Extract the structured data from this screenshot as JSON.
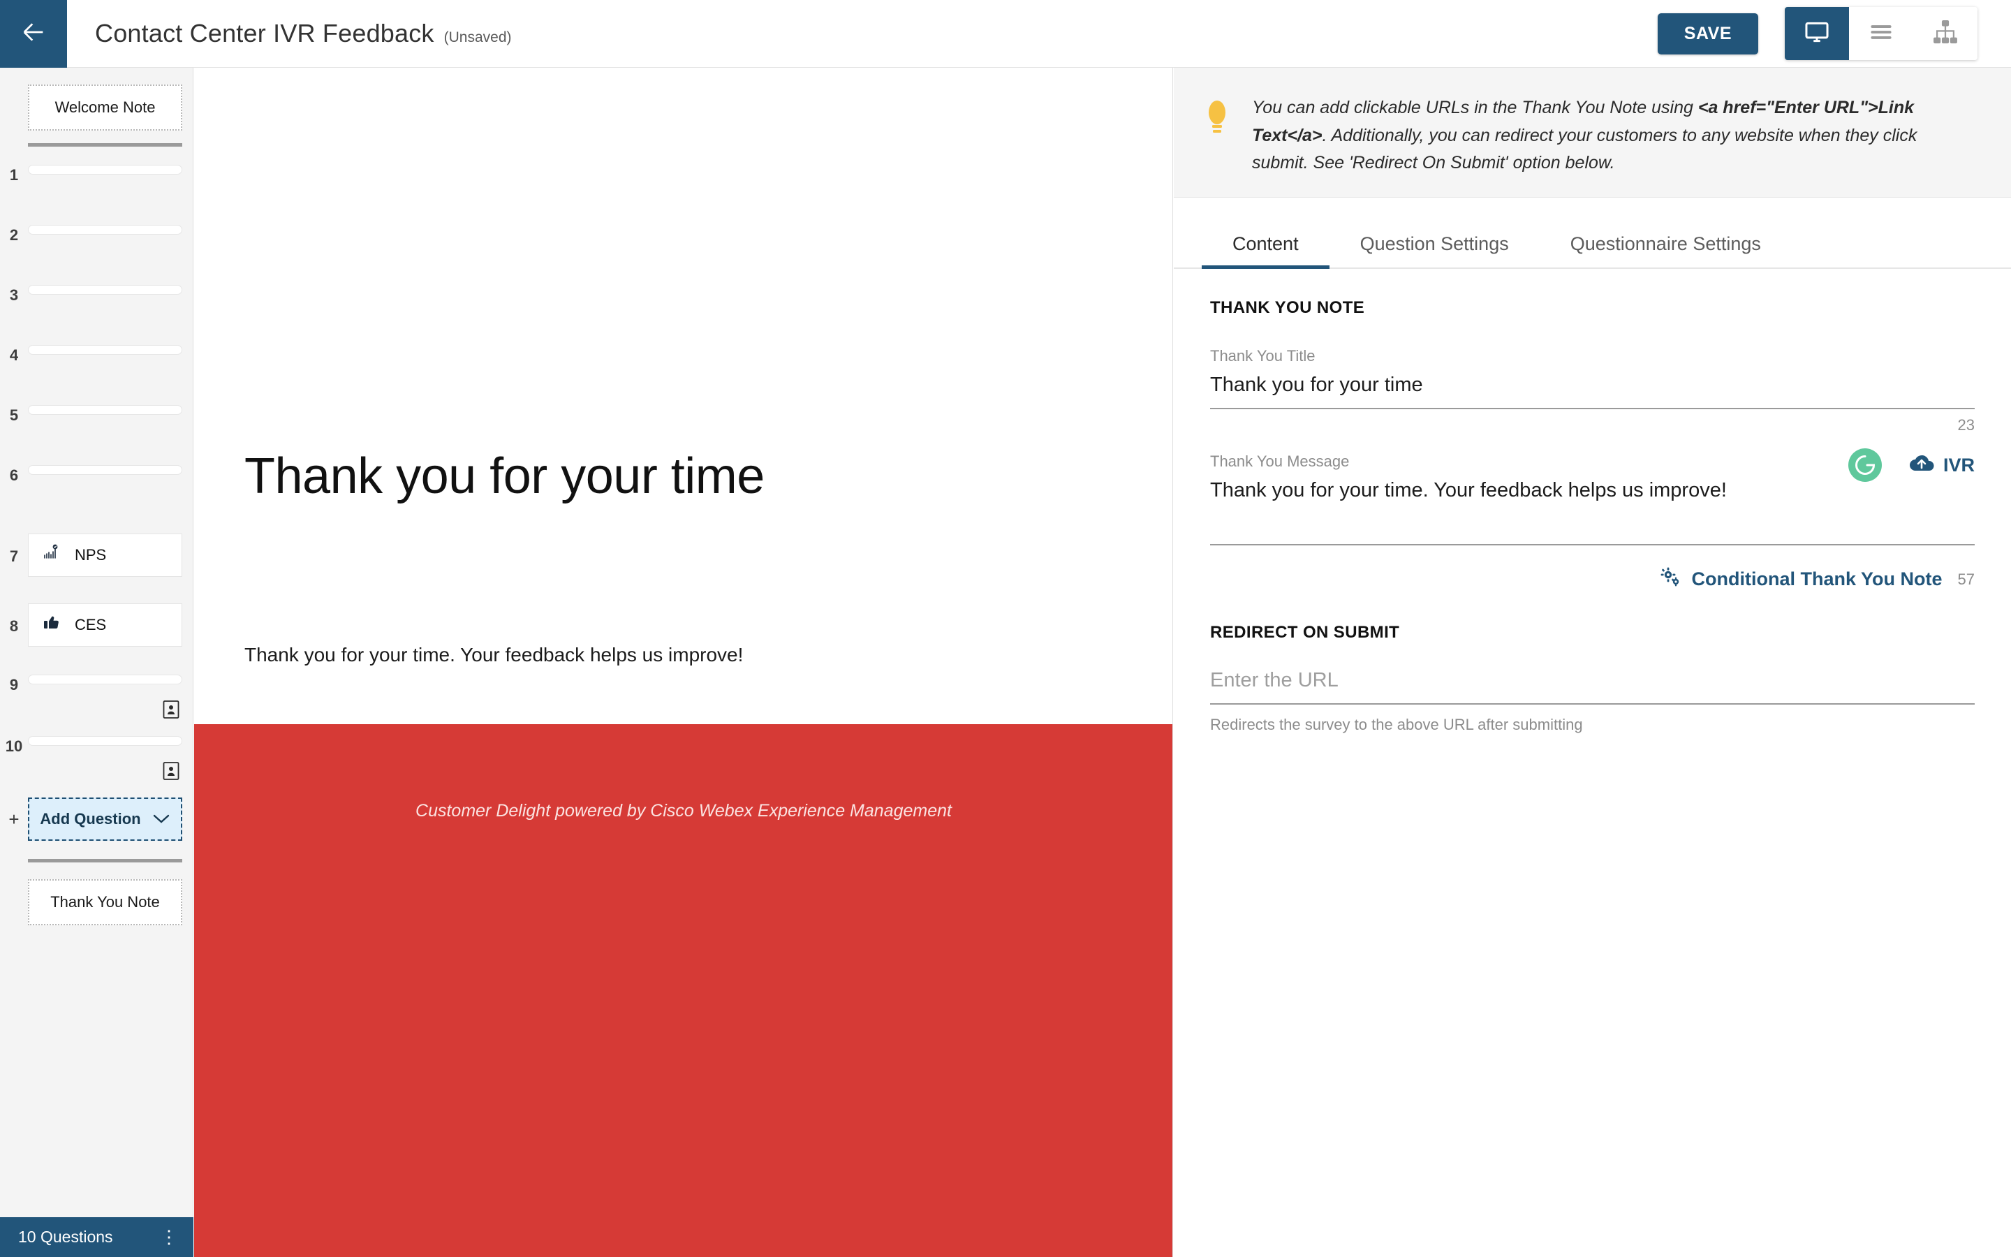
{
  "header": {
    "back_icon": "arrow-left-icon",
    "title": "Contact Center IVR Feedback",
    "unsaved_label": "(Unsaved)",
    "save_label": "SAVE",
    "view_modes": [
      {
        "name": "desktop-preview",
        "icon": "monitor-icon",
        "active": true
      },
      {
        "name": "list-view",
        "icon": "hamburger-icon",
        "active": false
      },
      {
        "name": "flow-view",
        "icon": "sitemap-icon",
        "active": false
      }
    ]
  },
  "sidebar": {
    "welcome_note_label": "Welcome Note",
    "questions": [
      {
        "number": "1",
        "type": "bar",
        "label": ""
      },
      {
        "number": "2",
        "type": "bar",
        "label": ""
      },
      {
        "number": "3",
        "type": "bar",
        "label": ""
      },
      {
        "number": "4",
        "type": "bar",
        "label": ""
      },
      {
        "number": "5",
        "type": "bar",
        "label": ""
      },
      {
        "number": "6",
        "type": "bar",
        "label": ""
      },
      {
        "number": "7",
        "type": "chip",
        "label": "NPS",
        "icon": "nps-chart-icon"
      },
      {
        "number": "8",
        "type": "chip",
        "label": "CES",
        "icon": "thumbs-up-icon"
      },
      {
        "number": "9",
        "type": "bar",
        "label": "",
        "badge": "contact-card-icon"
      },
      {
        "number": "10",
        "type": "bar",
        "label": "",
        "badge": "contact-card-icon"
      }
    ],
    "add_question_label": "Add Question",
    "add_question_icon": "chevron-down-icon",
    "add_plus": "+",
    "thank_you_note_label": "Thank You Note",
    "status_label": "10 Questions",
    "status_menu_icon": "kebab-menu-icon"
  },
  "preview": {
    "title": "Thank you for your time",
    "message": "Thank you for your time. Your feedback helps us improve!",
    "footer_text": "Customer Delight powered by Cisco Webex Experience Management",
    "footer_color": "#D63A36"
  },
  "right_panel": {
    "tip": {
      "icon": "lightbulb-icon",
      "part1": "You can add clickable URLs in the Thank You Note using ",
      "code1": "<a href=\"Enter URL\">Link Text</a>",
      "part2": ". Additionally, you can redirect your customers to any website when they click submit. See 'Redirect On Submit' option below."
    },
    "tabs": [
      {
        "label": "Content",
        "active": true
      },
      {
        "label": "Question Settings",
        "active": false
      },
      {
        "label": "Questionnaire Settings",
        "active": false
      }
    ],
    "thank_you_section": {
      "heading": "THANK YOU NOTE",
      "title_field": {
        "label": "Thank You Title",
        "value": "Thank you for your time",
        "char_count": "23"
      },
      "message_field": {
        "label": "Thank You Message",
        "value": "Thank you for your time. Your feedback helps us improve!",
        "char_count": "57",
        "grammar_icon": "grammarly-icon",
        "ivr_icon": "cloud-upload-icon",
        "ivr_label": "IVR"
      },
      "conditional_link": {
        "icon": "gears-icon",
        "label": "Conditional Thank You Note"
      }
    },
    "redirect_section": {
      "heading": "REDIRECT ON SUBMIT",
      "url_placeholder": "Enter the URL",
      "url_value": "",
      "hint": "Redirects the survey to the above URL after submitting"
    }
  },
  "colors": {
    "brand_blue": "#22557A",
    "accent_red": "#D63A36",
    "accent_green": "#5FC89C",
    "add_question_bg": "#DDEFFB"
  }
}
